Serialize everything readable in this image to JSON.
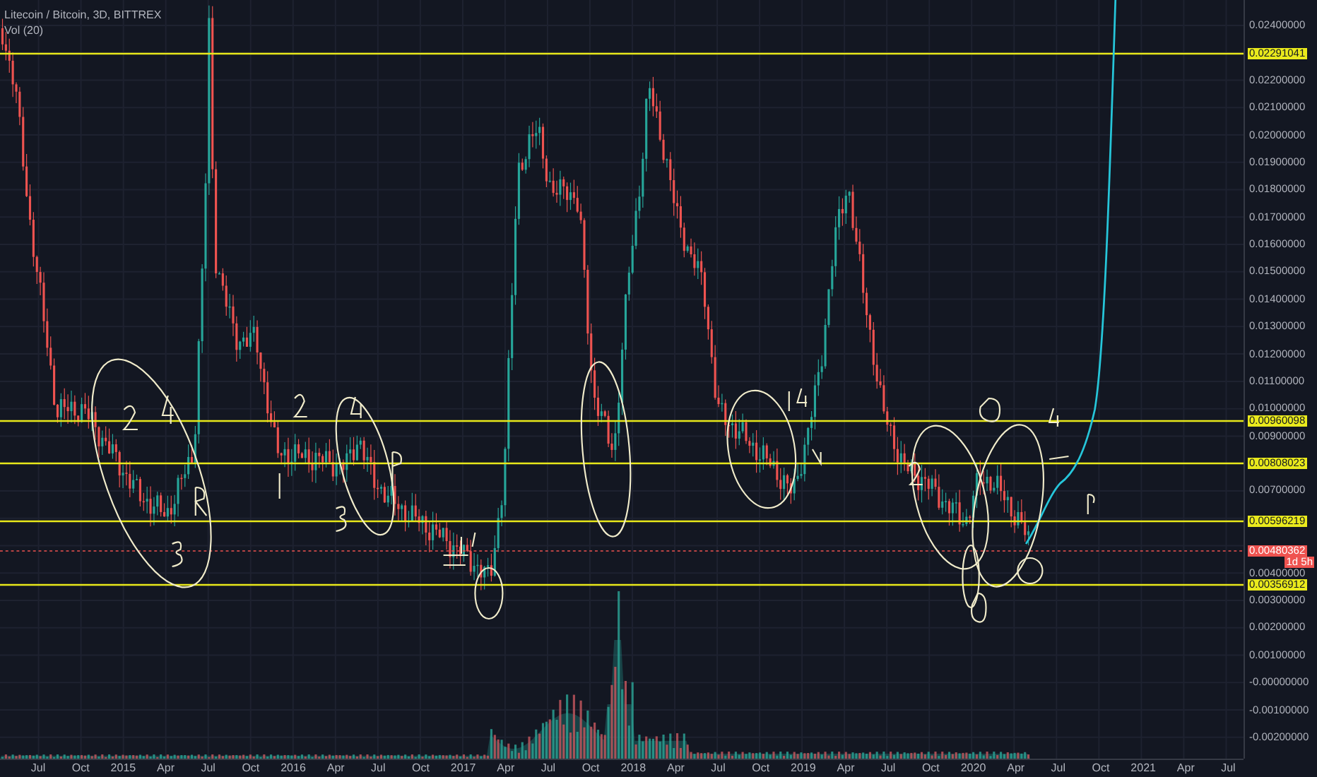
{
  "header": {
    "symbol": "Litecoin / Bitcoin, 3D, BITTREX",
    "indicator": "Vol (20)"
  },
  "price_axis": {
    "ticks": [
      "0.02400000",
      "0.02200000",
      "0.02100000",
      "0.02000000",
      "0.01900000",
      "0.01800000",
      "0.01700000",
      "0.01600000",
      "0.01500000",
      "0.01400000",
      "0.01300000",
      "0.01200000",
      "0.01100000",
      "0.01000000",
      "0.00900000",
      "0.00700000",
      "0.00400000",
      "0.00300000",
      "0.00200000",
      "0.00100000",
      "-0.00000000",
      "-0.00100000",
      "-0.00200000"
    ]
  },
  "horizontal_lines": [
    {
      "label": "0.02291041"
    },
    {
      "label": "0.00960098"
    },
    {
      "label": "0.00808023"
    },
    {
      "label": "0.00596219"
    },
    {
      "label": "0.00356912"
    }
  ],
  "last_price": {
    "label": "0.00480362",
    "countdown": "1d 5h"
  },
  "time_axis": {
    "labels": [
      "Jul",
      "Oct",
      "2015",
      "Apr",
      "Jul",
      "Oct",
      "2016",
      "Apr",
      "Jul",
      "Oct",
      "2017",
      "Apr",
      "Jul",
      "Oct",
      "2018",
      "Apr",
      "Jul",
      "Oct",
      "2019",
      "Apr",
      "Jul",
      "Oct",
      "2020",
      "Apr",
      "Jul",
      "Oct",
      "2021",
      "Apr",
      "Jul"
    ]
  }
}
